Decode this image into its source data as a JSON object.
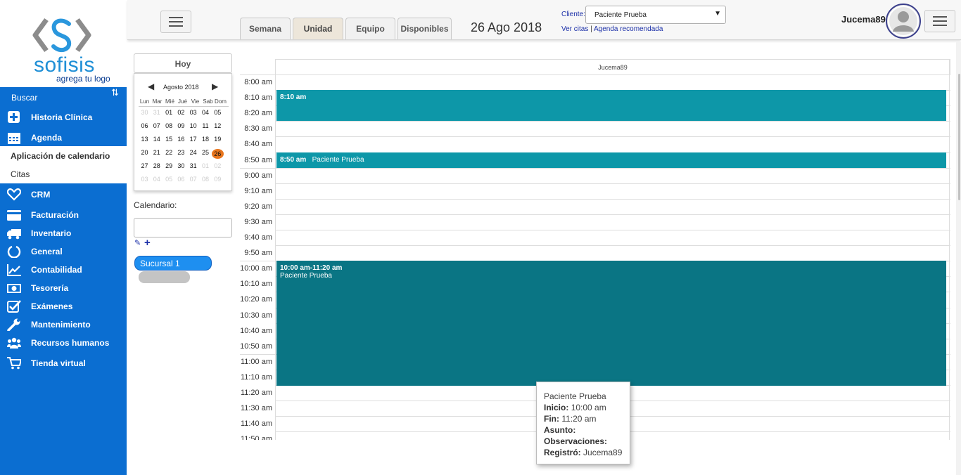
{
  "logo": {
    "text": "sofisis",
    "sub": "agrega tu logo"
  },
  "sidebar": {
    "search": "Buscar",
    "items": [
      {
        "label": "Historia Clínica",
        "icon": "plus-square-icon"
      },
      {
        "label": "Agenda",
        "icon": "calendar-icon"
      },
      {
        "label": "CRM",
        "icon": "heart-icon"
      },
      {
        "label": "Facturación",
        "icon": "credit-card-icon"
      },
      {
        "label": "Inventario",
        "icon": "truck-icon"
      },
      {
        "label": "General",
        "icon": "circle-notch-icon"
      },
      {
        "label": "Contabilidad",
        "icon": "line-chart-icon"
      },
      {
        "label": "Tesorería",
        "icon": "money-icon"
      },
      {
        "label": "Exámenes",
        "icon": "check-square-icon"
      },
      {
        "label": "Mantenimiento",
        "icon": "wrench-icon"
      },
      {
        "label": "Recursos humanos",
        "icon": "users-icon"
      },
      {
        "label": "Tienda virtual",
        "icon": "cart-icon"
      }
    ],
    "submenu": {
      "calendar_app": "Aplicación de calendario",
      "citas": "Citas"
    }
  },
  "topbar": {
    "tabs": [
      {
        "label": "Semana",
        "active": false
      },
      {
        "label": "Unidad",
        "active": true
      },
      {
        "label": "Equipo",
        "active": false
      },
      {
        "label": "Disponibles",
        "active": false
      }
    ],
    "date": "26 Ago 2018",
    "client_label": "Cliente:",
    "client_value": "Paciente Prueba",
    "link_ver_citas": "Ver citas",
    "link_sep": "|",
    "link_agenda": "Agenda recomendada",
    "user": "Jucema89"
  },
  "left_panel": {
    "today": "Hoy",
    "month": "Agosto 2018",
    "weekdays": [
      "Lun",
      "Mar",
      "Mié",
      "Jué",
      "Vie",
      "Sab",
      "Dom"
    ],
    "weeks": [
      [
        "30",
        "31",
        "01",
        "02",
        "03",
        "04",
        "05"
      ],
      [
        "06",
        "07",
        "08",
        "09",
        "10",
        "11",
        "12"
      ],
      [
        "13",
        "14",
        "15",
        "16",
        "17",
        "18",
        "19"
      ],
      [
        "20",
        "21",
        "22",
        "23",
        "24",
        "25",
        "26"
      ],
      [
        "27",
        "28",
        "29",
        "30",
        "31",
        "01",
        "02"
      ],
      [
        "03",
        "04",
        "05",
        "06",
        "07",
        "08",
        "09"
      ]
    ],
    "calendar_label": "Calendario:",
    "branch": "Sucursal 1"
  },
  "schedule": {
    "column": "Jucema89",
    "times": [
      "8:00 am",
      "8:10 am",
      "8:20 am",
      "8:30 am",
      "8:40 am",
      "8:50 am",
      "9:00 am",
      "9:10 am",
      "9:20 am",
      "9:30 am",
      "9:40 am",
      "9:50 am",
      "10:00 am",
      "10:10 am",
      "10:20 am",
      "10:30 am",
      "10:40 am",
      "10:50 am",
      "11:00 am",
      "11:10 am",
      "11:20 am",
      "11:30 am",
      "11:40 am",
      "11:50 am"
    ],
    "events": [
      {
        "time": "8:10 am",
        "title": ""
      },
      {
        "time": "8:50 am",
        "title": "Paciente Prueba"
      },
      {
        "time": "10:00 am-11:20 am",
        "title": "Paciente Prueba"
      }
    ]
  },
  "tooltip": {
    "name": "Paciente Prueba",
    "start_label": "Inicio:",
    "start": "10:00 am",
    "end_label": "Fin:",
    "end": "11:20 am",
    "subject_label": "Asunto:",
    "notes_label": "Observaciones:",
    "registered_label": "Registró:",
    "registered": "Jucema89"
  },
  "colors": {
    "sidebar": "#0b6ed1",
    "event": "#0d97a8",
    "event_dark": "#0a7584",
    "today": "#e8761e"
  }
}
